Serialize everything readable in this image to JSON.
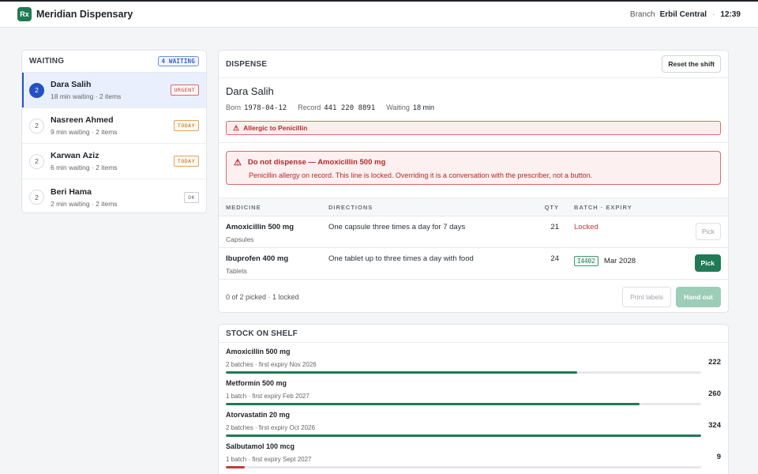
{
  "app": {
    "logo_text": "Rx",
    "title": "Meridian Dispensary",
    "branch_label": "Branch",
    "branch": "Erbil Central",
    "separator": "·",
    "time": "12:39"
  },
  "waiting": {
    "title": "WAITING",
    "badge": "4 WAITING",
    "rows": [
      {
        "num": "2",
        "name": "Dara Salih",
        "meta": "18 min waiting · 2 items",
        "tag": "URGENT",
        "tag_type": "urgent"
      },
      {
        "num": "2",
        "name": "Nasreen Ahmed",
        "meta": "9 min waiting · 2 items",
        "tag": "TODAY",
        "tag_type": "today"
      },
      {
        "num": "2",
        "name": "Karwan Aziz",
        "meta": "6 min waiting · 2 items",
        "tag": "TODAY",
        "tag_type": "today"
      },
      {
        "num": "2",
        "name": "Beri Hama",
        "meta": "2 min waiting · 2 items",
        "tag": "OK",
        "tag_type": "ok"
      }
    ]
  },
  "dispense": {
    "title": "DISPENSE",
    "reset_label": "Reset the shift",
    "patient": {
      "name": "Dara Salih",
      "born_label": "Born",
      "born": "1978-04-12",
      "record_label": "Record",
      "record": "441 220 8891",
      "waiting_label": "Waiting",
      "waiting": "18 min"
    },
    "allergy": "Allergic to Penicillin",
    "warning": {
      "title": "Do not dispense — Amoxicillin 500 mg",
      "body": "Penicillin allergy on record. This line is locked. Overriding it is a conversation with the prescriber, not a button."
    },
    "columns": {
      "medicine": "MEDICINE",
      "directions": "DIRECTIONS",
      "qty": "QTY",
      "batch": "BATCH · EXPIRY"
    },
    "lines": [
      {
        "name": "Amoxicillin 500 mg",
        "form": "Capsules",
        "directions": "One capsule three times a day for 7 days",
        "qty": "21",
        "status": "Locked",
        "pick": "Pick"
      },
      {
        "name": "Ibuprofen 400 mg",
        "form": "Tablets",
        "directions": "One tablet up to three times a day with food",
        "qty": "24",
        "batch": "I4402",
        "expiry": "Mar 2028",
        "pick": "Pick"
      }
    ],
    "footer": {
      "status": "0 of 2 picked · 1 locked",
      "print_label": "Print labels",
      "hand_label": "Hand out"
    }
  },
  "stock": {
    "title": "STOCK ON SHELF",
    "items": [
      {
        "name": "Amoxicillin 500 mg",
        "meta": "2 batches · first expiry Nov 2026",
        "qty": "222",
        "level": 0.74,
        "color": "#1f7a55"
      },
      {
        "name": "Metformin 500 mg",
        "meta": "1 batch · first expiry Feb 2027",
        "qty": "260",
        "level": 0.87,
        "color": "#1f7a55"
      },
      {
        "name": "Atorvastatin 20 mg",
        "meta": "2 batches · first expiry Oct 2026",
        "qty": "324",
        "level": 1.0,
        "color": "#1f7a55"
      },
      {
        "name": "Salbutamol 100 mcg",
        "meta": "1 batch · first expiry Sept 2027",
        "qty": "9",
        "level": 0.04,
        "color": "#c23b3b"
      }
    ]
  }
}
